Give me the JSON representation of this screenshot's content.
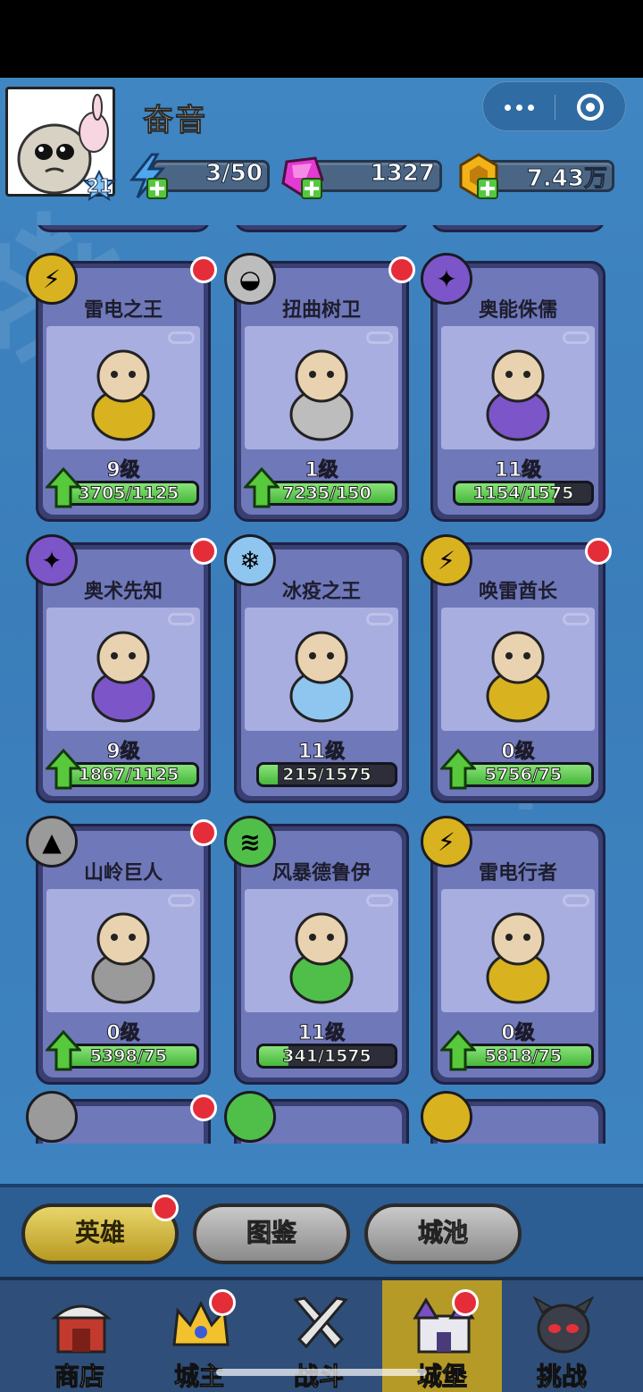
{
  "player": {
    "name": "奋音",
    "level": "21"
  },
  "resources": {
    "energy": "3/50",
    "gems": "1327",
    "gold": "7.43万"
  },
  "heroes": [
    {
      "name": "雷电之王",
      "level": "9级",
      "progress": "3705/1125",
      "fill": 1.0,
      "element": "lightning",
      "elem_color": "#d9b21f",
      "upgradable": true,
      "dot": true
    },
    {
      "name": "扭曲树卫",
      "level": "1级",
      "progress": "7235/150",
      "fill": 1.0,
      "element": "neutral",
      "elem_color": "#bdbdbd",
      "upgradable": true,
      "dot": true
    },
    {
      "name": "奥能侏儒",
      "level": "11级",
      "progress": "1154/1575",
      "fill": 0.73,
      "element": "arcane",
      "elem_color": "#7c55c9",
      "upgradable": false,
      "dot": false
    },
    {
      "name": "奥术先知",
      "level": "9级",
      "progress": "1867/1125",
      "fill": 1.0,
      "element": "arcane",
      "elem_color": "#7c55c9",
      "upgradable": true,
      "dot": true
    },
    {
      "name": "冰疫之王",
      "level": "11级",
      "progress": "215/1575",
      "fill": 0.14,
      "element": "ice",
      "elem_color": "#8fc6ef",
      "upgradable": false,
      "dot": false
    },
    {
      "name": "唤雷酋长",
      "level": "0级",
      "progress": "5756/75",
      "fill": 1.0,
      "element": "lightning",
      "elem_color": "#d9b21f",
      "upgradable": true,
      "dot": true
    },
    {
      "name": "山岭巨人",
      "level": "0级",
      "progress": "5398/75",
      "fill": 1.0,
      "element": "earth",
      "elem_color": "#9a9a9a",
      "upgradable": true,
      "dot": true
    },
    {
      "name": "风暴德鲁伊",
      "level": "11级",
      "progress": "341/1575",
      "fill": 0.22,
      "element": "wind",
      "elem_color": "#4fbf4a",
      "upgradable": false,
      "dot": false
    },
    {
      "name": "雷电行者",
      "level": "0级",
      "progress": "5818/75",
      "fill": 1.0,
      "element": "lightning",
      "elem_color": "#d9b21f",
      "upgradable": true,
      "dot": false
    }
  ],
  "tabs": [
    {
      "label": "英雄",
      "active": true,
      "dot": true
    },
    {
      "label": "图鉴",
      "active": false,
      "dot": false
    },
    {
      "label": "城池",
      "active": false,
      "dot": false
    }
  ],
  "nav": [
    {
      "label": "商店",
      "icon": "shop-icon",
      "active": false,
      "dot": false
    },
    {
      "label": "城主",
      "icon": "crown-icon",
      "active": false,
      "dot": true
    },
    {
      "label": "战斗",
      "icon": "swords-icon",
      "active": false,
      "dot": false
    },
    {
      "label": "城堡",
      "icon": "castle-icon",
      "active": true,
      "dot": true
    },
    {
      "label": "挑战",
      "icon": "monster-icon",
      "active": false,
      "dot": false
    }
  ]
}
